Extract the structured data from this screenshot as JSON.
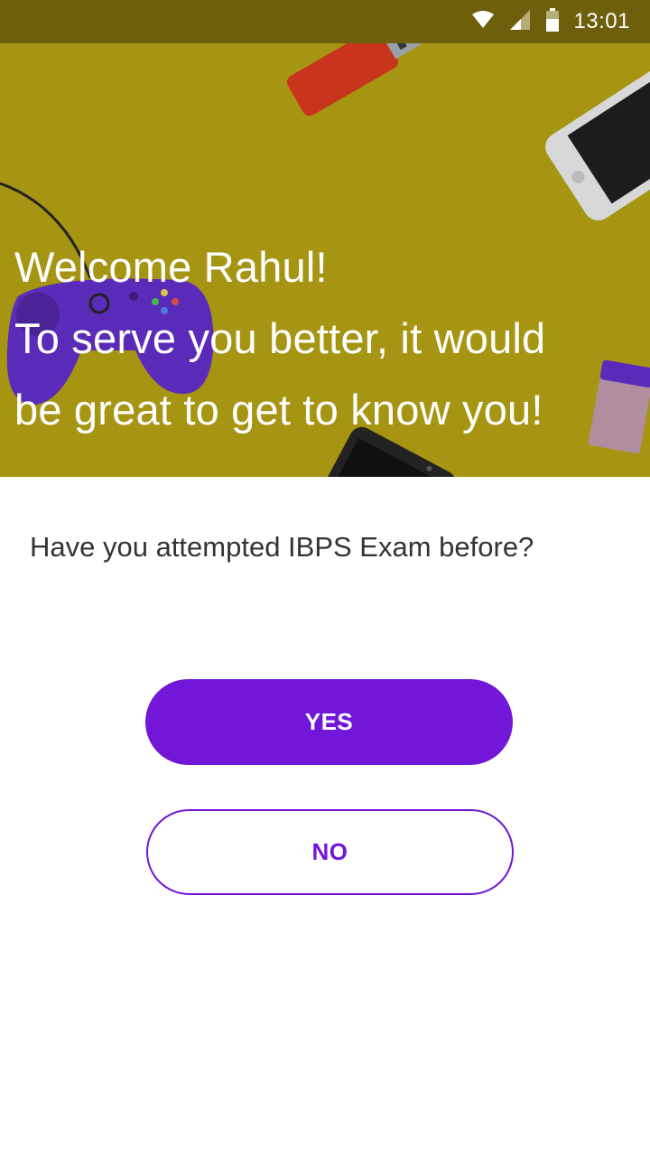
{
  "status_bar": {
    "time": "13:01",
    "icons": [
      "wifi-icon",
      "cell-signal-icon",
      "battery-icon"
    ]
  },
  "hero": {
    "line1": "Welcome Rahul!",
    "line2": "To serve you better, it would",
    "line3": "be great to get to know you!",
    "decor": [
      "usb-drive-illustration",
      "smartphone-illustration",
      "game-controller-illustration",
      "eraser-illustration",
      "phone-illustration"
    ]
  },
  "question": {
    "text": "Have you attempted IBPS Exam before?"
  },
  "buttons": {
    "yes_label": "YES",
    "no_label": "NO"
  },
  "colors": {
    "accent": "#7216d8",
    "hero_background": "#a69512",
    "status_bar": "#6e5f0c"
  }
}
